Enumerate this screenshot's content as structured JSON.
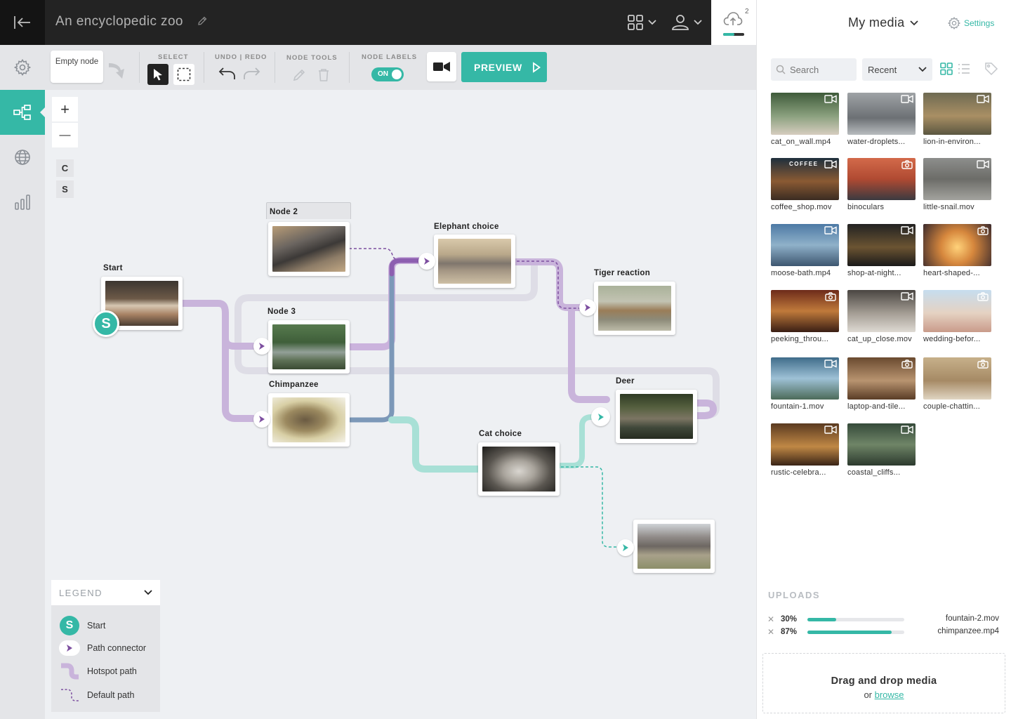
{
  "colors": {
    "accent": "#35b8a6",
    "hotspot_path": "#c9b4db",
    "connector_purple": "#7d4fa0"
  },
  "header": {
    "title": "An encyclopedic zoo",
    "upload_count": "2"
  },
  "toolbar": {
    "empty_node_label": "Empty node",
    "select_label": "SELECT",
    "undo_redo_label": "UNDO | REDO",
    "node_tools_label": "NODE TOOLS",
    "node_labels_label": "NODE LABELS",
    "toggle_state": "ON",
    "preview_label": "PREVIEW"
  },
  "rail": {
    "items": [
      "gear-icon",
      "node-map-icon",
      "globe-icon",
      "bar-chart-icon"
    ],
    "active": "node-map-icon"
  },
  "zoom": {
    "plus": "+",
    "minus": "—",
    "center": "C",
    "start": "S"
  },
  "nodes": {
    "start": "Start",
    "node2": "Node 2",
    "node3": "Node 3",
    "chimpanzee": "Chimpanzee",
    "elephant": "Elephant choice",
    "tiger": "Tiger reaction",
    "deer": "Deer",
    "cat": "Cat choice"
  },
  "start_badge": "S",
  "legend": {
    "title": "LEGEND",
    "items": [
      "Start",
      "Path connector",
      "Hotspot path",
      "Default path"
    ],
    "start_symbol": "S"
  },
  "panel": {
    "media_title": "My media",
    "settings_label": "Settings",
    "search_placeholder": "Search",
    "sort_value": "Recent"
  },
  "media": [
    {
      "name": "cat_on_wall.mp4",
      "type": "video"
    },
    {
      "name": "water-droplets...",
      "type": "video"
    },
    {
      "name": "lion-in-environ...",
      "type": "video"
    },
    {
      "name": "coffee_shop.mov",
      "type": "video",
      "overlay_text": "COFFEE"
    },
    {
      "name": "binoculars",
      "type": "photo"
    },
    {
      "name": "little-snail.mov",
      "type": "video"
    },
    {
      "name": "moose-bath.mp4",
      "type": "video"
    },
    {
      "name": "shop-at-night...",
      "type": "video"
    },
    {
      "name": "heart-shaped-...",
      "type": "photo"
    },
    {
      "name": "peeking_throu...",
      "type": "photo"
    },
    {
      "name": "cat_up_close.mov",
      "type": "video"
    },
    {
      "name": "wedding-befor...",
      "type": "photo"
    },
    {
      "name": "fountain-1.mov",
      "type": "video"
    },
    {
      "name": "laptop-and-tile...",
      "type": "photo"
    },
    {
      "name": "couple-chattin...",
      "type": "photo"
    },
    {
      "name": "rustic-celebra...",
      "type": "video"
    },
    {
      "name": "coastal_cliffs...",
      "type": "video"
    }
  ],
  "uploads": {
    "title": "UPLOADS",
    "items": [
      {
        "percent": "30%",
        "progress": 0.3,
        "name": "fountain-2.mov"
      },
      {
        "percent": "87%",
        "progress": 0.87,
        "name": "chimpanzee.mp4"
      }
    ]
  },
  "dropzone": {
    "title": "Drag and drop media",
    "or_text": "or",
    "browse_label": "browse"
  }
}
